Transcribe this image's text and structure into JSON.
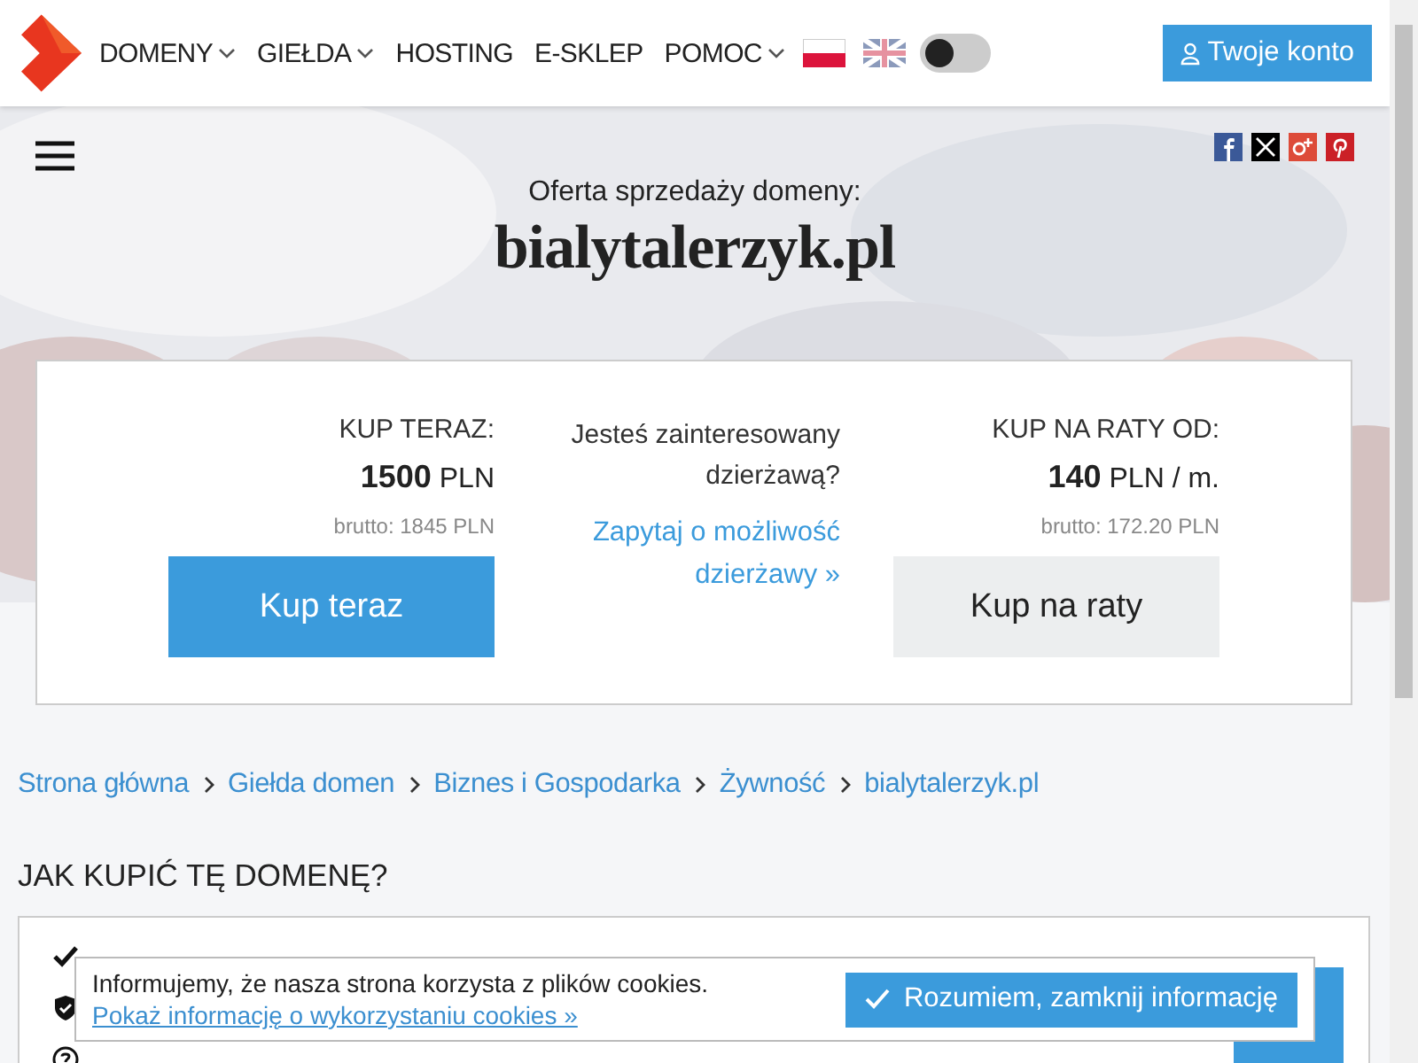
{
  "nav": {
    "items": [
      {
        "label": "DOMENY",
        "dropdown": true
      },
      {
        "label": "GIEŁDA",
        "dropdown": true
      },
      {
        "label": "HOSTING",
        "dropdown": false
      },
      {
        "label": "E-SKLEP",
        "dropdown": false
      },
      {
        "label": "POMOC",
        "dropdown": true
      }
    ],
    "dark_mode": {
      "on": false
    },
    "account_button": "Twoje konto"
  },
  "hero": {
    "subtitle": "Oferta sprzedaży domeny:",
    "domain": "bialytalerzyk.pl"
  },
  "offer": {
    "buy_now": {
      "label": "KUP TERAZ:",
      "price": "1500",
      "currency": "PLN",
      "gross": "brutto: 1845 PLN",
      "button": "Kup teraz"
    },
    "lease": {
      "question": "Jesteś zainteresowany dzierżawą?",
      "link": "Zapytaj o możliwość dzierżawy »"
    },
    "installments": {
      "label": "KUP NA RATY OD:",
      "price": "140",
      "currency": "PLN",
      "period": "/ m.",
      "gross": "brutto: 172.20 PLN",
      "button": "Kup na raty"
    }
  },
  "breadcrumb": [
    "Strona główna",
    "Giełda domen",
    "Biznes i Gospodarka",
    "Żywność",
    "bialytalerzyk.pl"
  ],
  "how_to_buy": {
    "title": "JAK KUPIĆ TĘ DOMENĘ?",
    "items": [
      {
        "kind": "check"
      },
      {
        "kind": "shield"
      },
      {
        "kind": "help"
      }
    ]
  },
  "cookies": {
    "message": "Informujemy, że nasza strona korzysta z plików cookies.",
    "link": "Pokaż informację o wykorzystaniu cookies »",
    "button": "Rozumiem, zamknij informację"
  }
}
